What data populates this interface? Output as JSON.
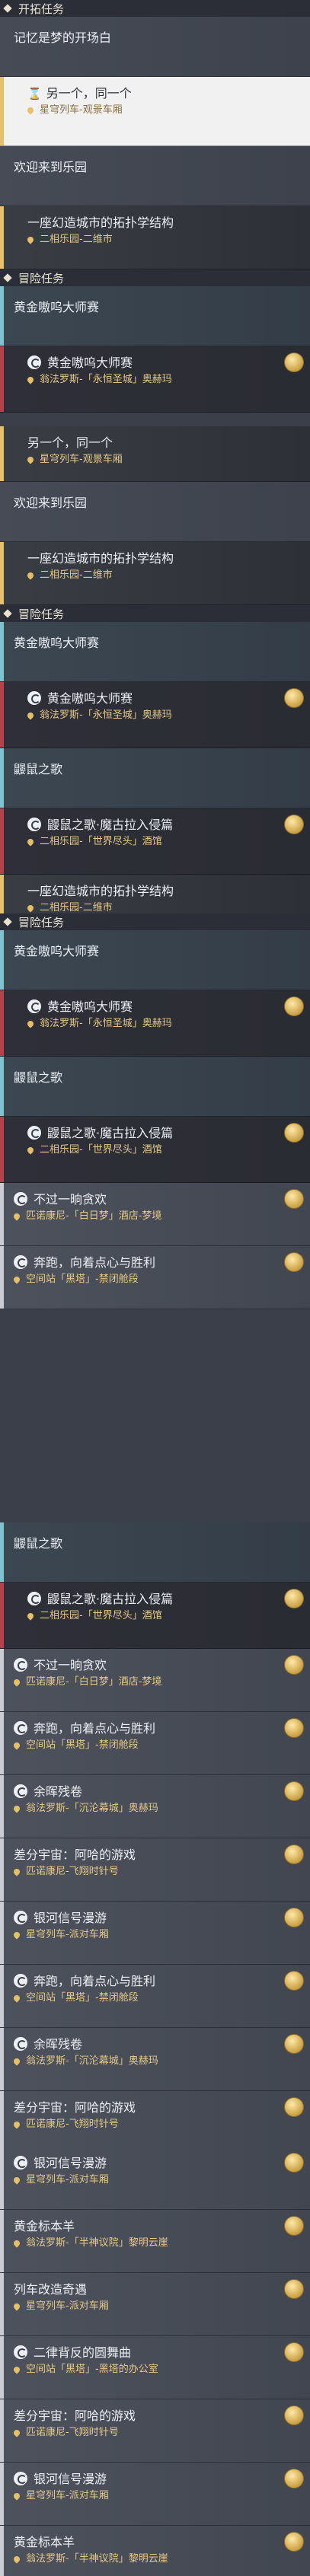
{
  "headers": {
    "exploration": "开拓任务",
    "adventure": "冒险任务"
  },
  "missions": {
    "dream_start": "记忆是梦的开场白",
    "another_me": "另一个，同一个",
    "welcome": "欢迎来到乐园",
    "dream_city": "一座幻造城市的拓扑学结构",
    "golden_master": "黄金嗷呜大师赛",
    "rat_song": "鼹鼠之歌",
    "rat_song_invasion": "鼹鼠之歌·魔古拉入侵篇",
    "no_gluttony": "不过一晌贪欢",
    "run_snacks": "奔跑，向着点心与胜利",
    "afterglow": "余晖残卷",
    "diff_universe": "差分宇宙：阿哈的游戏",
    "galaxy_signal": "银河信号漫游",
    "golden_sheep": "黄金标本羊",
    "train_remodel": "列车改造奇遇",
    "two_rhythm": "二律背反的圆舞曲"
  },
  "locations": {
    "train_observation": "星穹列车-观景车厢",
    "penacony_dream": "二相乐园-二维市",
    "amphoreus_eternal": "翁法罗斯-「永恒圣城」奥赫玛",
    "penacony_world_end": "二相乐园-「世界尽头」酒馆",
    "penacony_white_dream": "匹诺康尼-「白日梦」酒店-梦境",
    "herta_black_tower": "空间站「黑塔」-禁闭舱段",
    "amphoreus_sinking": "翁法罗斯-「沉沦幕城」奥赫玛",
    "penacony_flying": "匹诺康尼-飞翔时针号",
    "train_dispatch": "星穹列车-派对车厢",
    "penacony_half_god": "翁法罗斯-「半神议院」黎明云崖",
    "herta_office": "空间站「黑塔」-黑塔的办公室",
    "amphoreus_sinking_2": "翁法罗斯-「沉沦幕城」奥赫玛"
  }
}
